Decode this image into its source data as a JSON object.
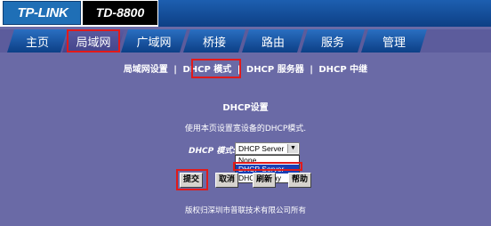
{
  "header": {
    "brand": "TP-LINK",
    "model": "TD-8800"
  },
  "tabs": [
    {
      "label": "主页"
    },
    {
      "label": "局域网"
    },
    {
      "label": "广域网"
    },
    {
      "label": "桥接"
    },
    {
      "label": "路由"
    },
    {
      "label": "服务"
    },
    {
      "label": "管理"
    }
  ],
  "subnav": {
    "items": [
      "局域网设置",
      "DHCP 模式",
      "DHCP 服务器",
      "DHCP 中继"
    ],
    "separator": "|"
  },
  "page": {
    "title": "DHCP设置",
    "description": "使用本页设置宽设备的DHCP模式."
  },
  "form": {
    "mode_label": "DHCP 模式:",
    "mode_value": "DHCP Server",
    "options": [
      "None",
      "DHCP Server",
      "DHCP Relay"
    ]
  },
  "buttons": {
    "submit": "提交",
    "cancel": "取消",
    "refresh": "刷新",
    "help": "帮助"
  },
  "footer": {
    "copyright": "版权归深圳市普联技术有限公司所有"
  },
  "colors": {
    "background": "#6a6aa6",
    "tab_blue": "#1f5fae",
    "highlight_red": "#e21a1a",
    "selection": "#1a3fb4"
  }
}
